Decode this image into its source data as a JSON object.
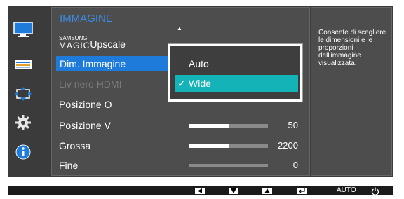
{
  "sidebar": {
    "items": [
      {
        "icon": "picture-icon",
        "active": true
      },
      {
        "icon": "screen-icon",
        "active": false
      },
      {
        "icon": "size-position-icon",
        "active": false
      },
      {
        "icon": "gear-icon",
        "active": false
      },
      {
        "icon": "info-icon",
        "active": false
      }
    ]
  },
  "menu": {
    "title": "IMMAGINE",
    "rows": [
      {
        "label": "MAGICUpscale",
        "magic_top": "SAMSUNG",
        "magic_bottom": "MAGIC",
        "suffix": "Upscale"
      },
      {
        "label": "Dim. Immagine",
        "selected": true
      },
      {
        "label": "Liv nero HDMI",
        "disabled": true
      },
      {
        "label": "Posizione O"
      },
      {
        "label": "Posizione V",
        "value": "50",
        "fraction": 0.5
      },
      {
        "label": "Grossa",
        "value": "2200",
        "fraction": 0.5
      },
      {
        "label": "Fine",
        "value": "0",
        "fraction": 0
      }
    ]
  },
  "submenu": {
    "options": [
      {
        "label": "Auto",
        "selected": false
      },
      {
        "label": "Wide",
        "selected": true
      }
    ]
  },
  "info": {
    "text": "Consente di scegliere le dimensioni e le proporzioni dell'immagine visualizzata."
  },
  "bottom_bar": {
    "buttons": [
      "left-arrow-icon",
      "down-arrow-icon",
      "up-arrow-icon",
      "enter-icon"
    ],
    "auto_label": "AUTO"
  }
}
